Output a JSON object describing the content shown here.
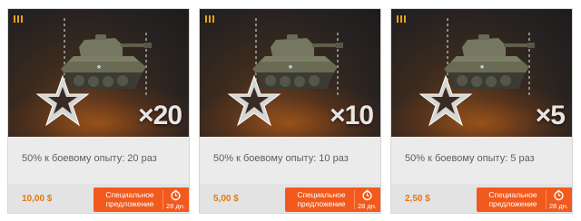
{
  "cards": [
    {
      "multiplier": "×20",
      "description": "50% к боевому опыту: 20 раз",
      "price": "10,00 $",
      "offer_label": "Специальное предложение",
      "days_left": "28 дн."
    },
    {
      "multiplier": "×10",
      "description": "50% к боевому опыту: 10 раз",
      "price": "5,00 $",
      "offer_label": "Специальное предложение",
      "days_left": "28 дн."
    },
    {
      "multiplier": "×5",
      "description": "50% к боевому опыту: 5 раз",
      "price": "2,50 $",
      "offer_label": "Специальное предложение",
      "days_left": "28 дн."
    }
  ],
  "icons": {
    "tier": "tier-badge-icon",
    "tank": "tank-icon",
    "star": "star-icon",
    "timer": "timer-icon"
  },
  "colors": {
    "accent": "#f15a1c",
    "price": "#e4780f",
    "tier_badge": "#e5a21b"
  }
}
